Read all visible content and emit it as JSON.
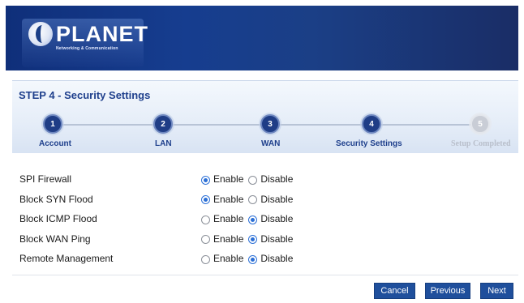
{
  "brand": {
    "name": "PLANET",
    "tagline": "Networking & Communication"
  },
  "wizard": {
    "title": "STEP 4 - Security Settings",
    "steps": [
      {
        "number": "1",
        "label": "Account",
        "state": "done"
      },
      {
        "number": "2",
        "label": "LAN",
        "state": "done"
      },
      {
        "number": "3",
        "label": "WAN",
        "state": "done"
      },
      {
        "number": "4",
        "label": "Security Settings",
        "state": "current"
      },
      {
        "number": "5",
        "label": "Setup Completed",
        "state": "disabled"
      }
    ]
  },
  "settings": [
    {
      "label": "SPI Firewall",
      "enable_label": "Enable",
      "disable_label": "Disable",
      "value": "enable"
    },
    {
      "label": "Block SYN Flood",
      "enable_label": "Enable",
      "disable_label": "Disable",
      "value": "enable"
    },
    {
      "label": "Block ICMP Flood",
      "enable_label": "Enable",
      "disable_label": "Disable",
      "value": "disable"
    },
    {
      "label": "Block WAN Ping",
      "enable_label": "Enable",
      "disable_label": "Disable",
      "value": "disable"
    },
    {
      "label": "Remote Management",
      "enable_label": "Enable",
      "disable_label": "Disable",
      "value": "disable"
    }
  ],
  "buttons": {
    "cancel": "Cancel",
    "previous": "Previous",
    "next": "Next"
  },
  "colors": {
    "brand_blue": "#1f3d86",
    "accent_radio": "#2b6fd6",
    "button": "#1f4f9c"
  }
}
